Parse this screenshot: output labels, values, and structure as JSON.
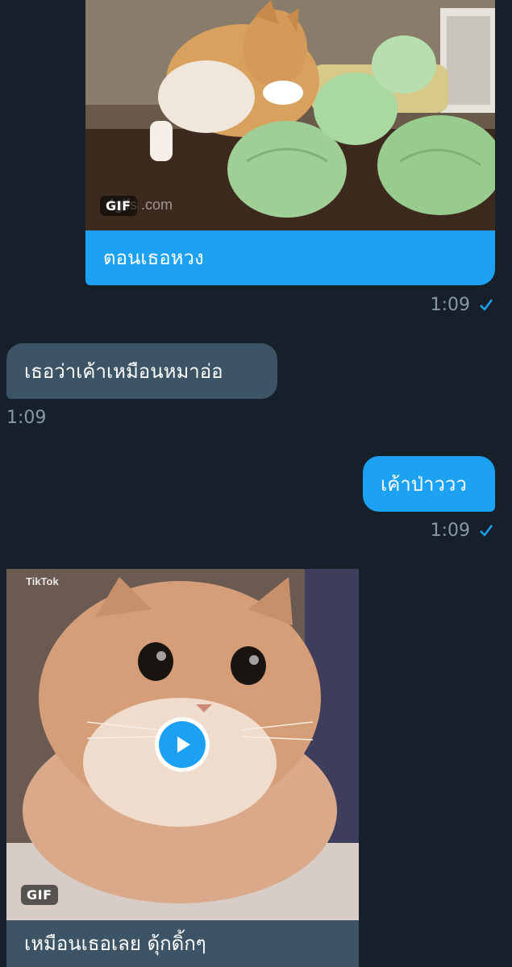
{
  "colors": {
    "background": "#15202b",
    "sent_bubble": "#1da1f2",
    "received_bubble": "#3d5466",
    "timestamp": "#8899a6",
    "read_check": "#1da1f2"
  },
  "messages": [
    {
      "direction": "sent",
      "type": "gif",
      "gif_badge": "GIF",
      "watermark": "4gifs .com",
      "caption": "ตอนเธอหวง",
      "time": "1:09",
      "status_icon": "check-icon"
    },
    {
      "direction": "received",
      "type": "text",
      "text": "เธอว่าเค้าเหมือนหมาอ่อ",
      "time": "1:09"
    },
    {
      "direction": "sent",
      "type": "text",
      "text": "เค้าป่าววว",
      "time": "1:09",
      "status_icon": "check-icon"
    },
    {
      "direction": "received",
      "type": "gif",
      "gif_badge": "GIF",
      "watermark": "TikTok",
      "play_icon": "play-icon",
      "caption": "เหมือนเธอเลย ดุ้กดิ้กๆ"
    }
  ]
}
